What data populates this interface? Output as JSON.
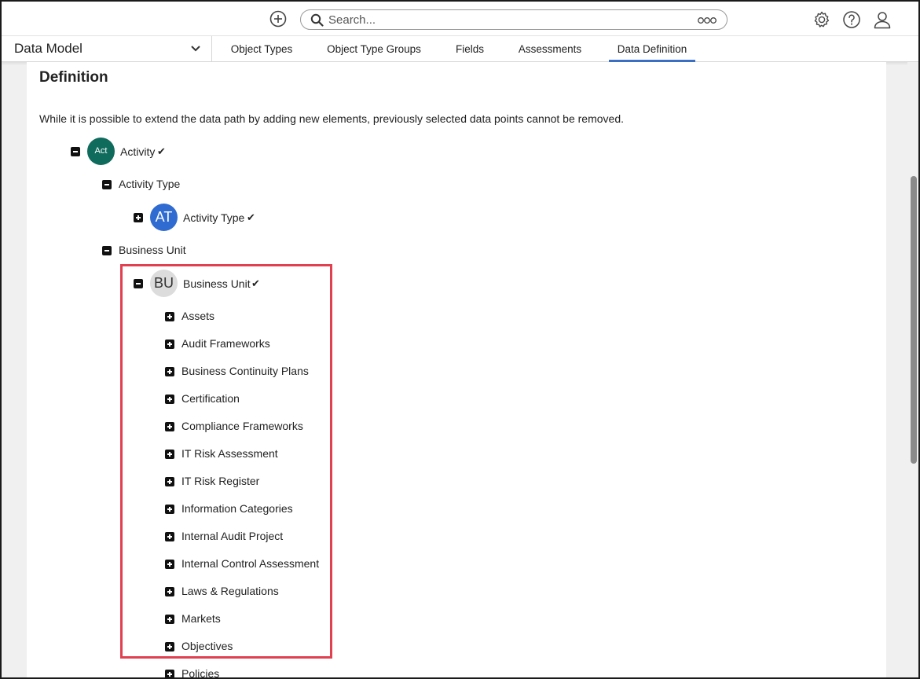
{
  "topbar": {
    "search_placeholder": "Search...",
    "icons": [
      "add-icon",
      "search-icon",
      "more-options-icon",
      "gear-icon",
      "help-icon",
      "user-icon"
    ]
  },
  "navbar": {
    "model_select": "Data Model",
    "tabs": [
      "Object Types",
      "Object Type Groups",
      "Fields",
      "Assessments",
      "Data Definition"
    ],
    "active_tab": "Data Definition"
  },
  "definition": {
    "title": "Definition",
    "note": "While it is possible to extend the data path by adding new elements, previously selected data points cannot be removed."
  },
  "tree": {
    "activity": {
      "avatar": "Act",
      "label": "Activity",
      "check": "✔"
    },
    "activity_type_group": "Activity Type",
    "activity_type": {
      "avatar": "AT",
      "label": "Activity Type",
      "check": "✔"
    },
    "business_unit_group": "Business Unit",
    "business_unit": {
      "avatar": "BU",
      "label": "Business Unit",
      "check": "✔"
    },
    "children": [
      "Assets",
      "Audit Frameworks",
      "Business Continuity Plans",
      "Certification",
      "Compliance Frameworks",
      "IT Risk Assessment",
      "IT Risk Register",
      "Information Categories",
      "Internal Audit Project",
      "Internal Control Assessment",
      "Laws & Regulations",
      "Markets",
      "Objectives",
      "Policies"
    ]
  },
  "colors": {
    "act_avatar": "#0f6b5c",
    "at_avatar": "#2f6bd0",
    "bu_avatar": "#dcdcdc",
    "active_tab_underline": "#3b6fc4",
    "highlight": "#e04050"
  }
}
